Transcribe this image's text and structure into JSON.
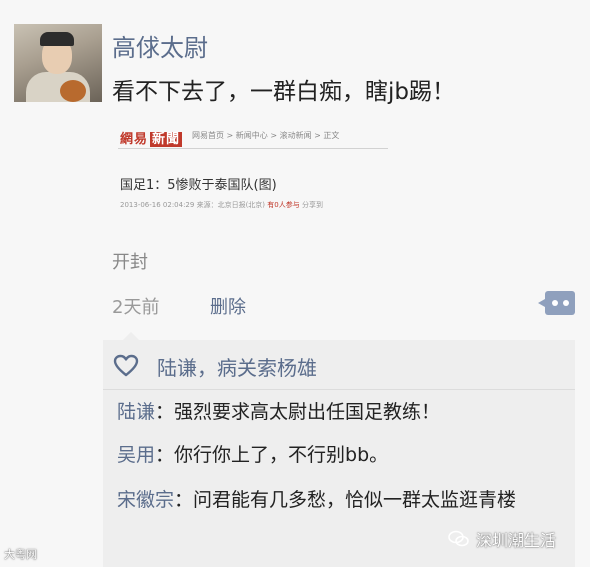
{
  "post": {
    "username": "高俅太尉",
    "text": "看不下去了，一群白痴，瞎jb踢！",
    "open_label": "开封",
    "time": "2天前",
    "delete_label": "删除"
  },
  "news_card": {
    "logo_part1": "網易",
    "logo_part2": "新聞",
    "breadcrumb": "网易首页 > 新闻中心 > 滚动新闻 > 正文",
    "title": "国足1：5惨败于泰国队(图)",
    "meta_date": "2013-06-16 02:04:29 来源：北京日报(北京)",
    "meta_hot": "有0人参与",
    "meta_share": "分享到"
  },
  "likes": {
    "icon": "heart-icon",
    "names": "陆谦，病关索杨雄"
  },
  "comments": [
    {
      "name": "陆谦",
      "text": "：强烈要求高太尉出任国足教练！"
    },
    {
      "name": "吴用",
      "text": "：你行你上了，不行别bb。"
    },
    {
      "name": "宋徽宗",
      "text": "：问君能有几多愁，恰似一群太监逛青楼"
    }
  ],
  "watermarks": {
    "left": "大粤网",
    "right": "深圳潮生活"
  },
  "colors": {
    "link": "#5b6d8c",
    "comment_button": "#8fa0bd",
    "news_red": "#c0392b"
  }
}
